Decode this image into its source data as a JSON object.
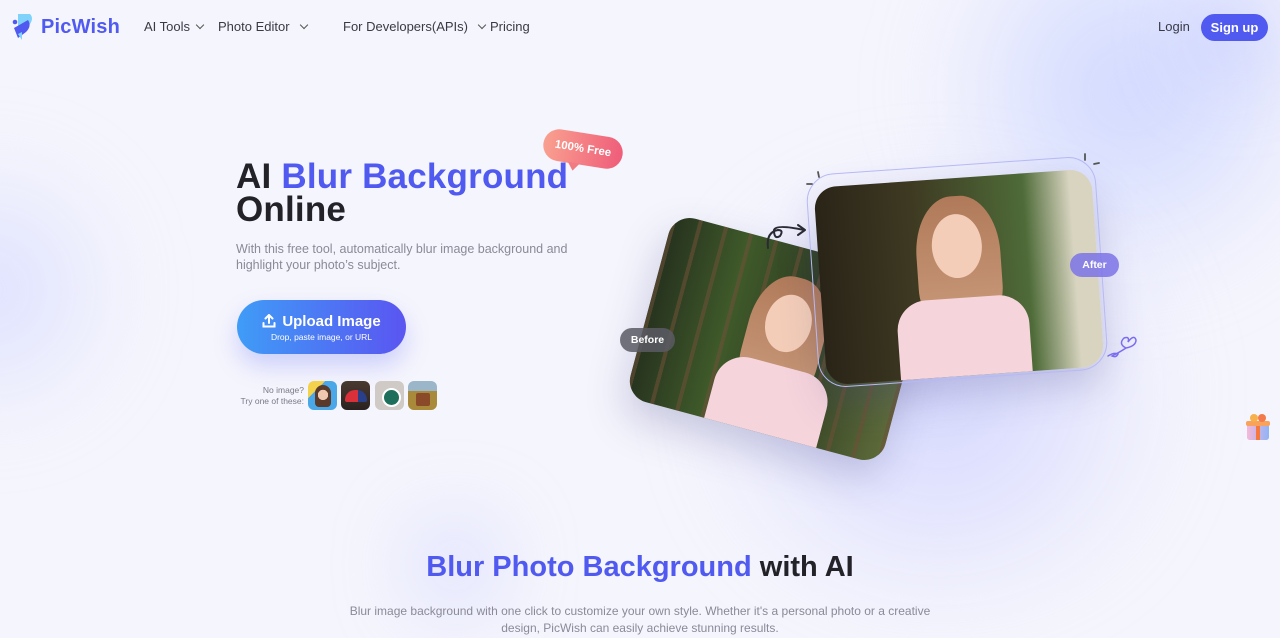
{
  "brand": {
    "name": "PicWish",
    "accent_color": "#5059f0"
  },
  "nav": {
    "items": [
      {
        "label": "AI Tools",
        "has_dropdown": true
      },
      {
        "label": "Photo Editor",
        "has_dropdown": true
      },
      {
        "label": "For Developers(APIs)",
        "has_dropdown": true
      },
      {
        "label": "Pricing",
        "has_dropdown": false
      }
    ],
    "login_label": "Login",
    "signup_label": "Sign up"
  },
  "hero": {
    "title_prefix": "AI",
    "title_accent": "Blur Background",
    "title_suffix": "Online",
    "badge": "100% Free",
    "subtitle": "With this free tool, automatically blur image background and highlight your photo’s subject.",
    "upload": {
      "label": "Upload Image",
      "sublabel": "Drop, paste image, or URL",
      "icon": "upload-icon"
    },
    "samples": {
      "label_line1": "No image?",
      "label_line2": "Try one of these:",
      "items": [
        {
          "name": "woman-portrait"
        },
        {
          "name": "red-cap"
        },
        {
          "name": "coffee-cup-logo"
        },
        {
          "name": "landscape-chair"
        }
      ]
    },
    "comparison": {
      "before_label": "Before",
      "after_label": "After"
    }
  },
  "section2": {
    "title_accent": "Blur Photo Background",
    "title_rest": "with AI",
    "description": "Blur image background with one click to customize your own style. Whether it's a personal photo or a creative design, PicWish can easily achieve stunning results."
  },
  "floating": {
    "icon": "gift-icon"
  }
}
